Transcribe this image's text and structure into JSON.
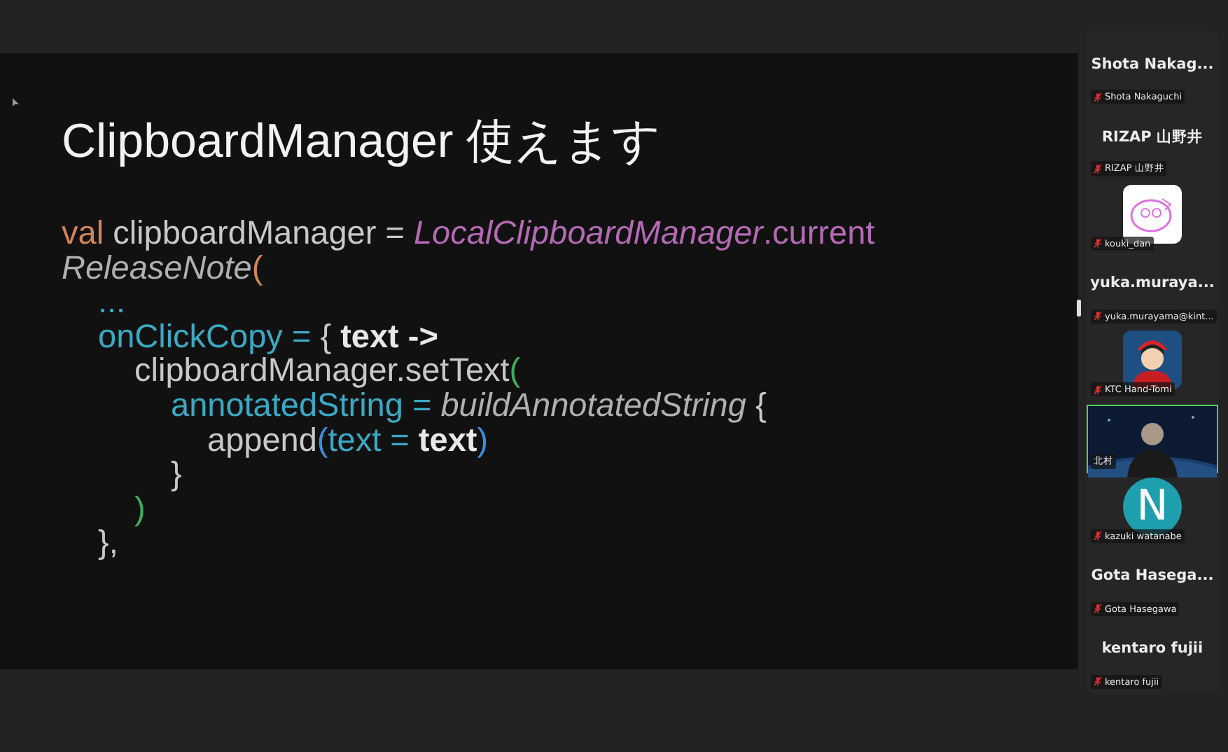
{
  "slide": {
    "title": "ClipboardManager 使えます",
    "code": [
      {
        "tokens": [
          {
            "text": "val ",
            "kind": "keyword"
          },
          {
            "text": "clipboardManager = ",
            "kind": "plain"
          },
          {
            "text": "LocalClipboardManager",
            "kind": "type"
          },
          {
            "text": ".current",
            "kind": "member"
          }
        ]
      },
      {
        "tokens": [
          {
            "text": "ReleaseNote",
            "kind": "italic"
          },
          {
            "text": "(",
            "kind": "paren-orange"
          }
        ],
        "children": [
          {
            "tokens": [
              {
                "text": "...",
                "kind": "param"
              }
            ]
          },
          {
            "tokens": [
              {
                "text": "onClickCopy = ",
                "kind": "param"
              },
              {
                "text": "{ ",
                "kind": "plain"
              },
              {
                "text": "text ->",
                "kind": "bold"
              }
            ],
            "children": [
              {
                "tokens": [
                  {
                    "text": "clipboardManager.setText",
                    "kind": "plain"
                  },
                  {
                    "text": "(",
                    "kind": "paren-green"
                  }
                ],
                "children": [
                  {
                    "tokens": [
                      {
                        "text": "annotatedString = ",
                        "kind": "param"
                      },
                      {
                        "text": "buildAnnotatedString",
                        "kind": "italic"
                      },
                      {
                        "text": " {",
                        "kind": "plain"
                      }
                    ],
                    "children": [
                      {
                        "tokens": [
                          {
                            "text": "append",
                            "kind": "plain"
                          },
                          {
                            "text": "(",
                            "kind": "paren-blue"
                          },
                          {
                            "text": "text = ",
                            "kind": "param"
                          },
                          {
                            "text": "text",
                            "kind": "bold"
                          },
                          {
                            "text": ")",
                            "kind": "paren-blue"
                          }
                        ]
                      }
                    ]
                  },
                  {
                    "tokens": [
                      {
                        "text": "}",
                        "kind": "plain"
                      }
                    ]
                  }
                ]
              },
              {
                "tokens": [
                  {
                    "text": ")",
                    "kind": "paren-green"
                  }
                ]
              }
            ]
          },
          {
            "tokens": [
              {
                "text": "},",
                "kind": "plain"
              }
            ]
          }
        ]
      }
    ]
  },
  "participants": [
    {
      "kind": "name",
      "display_name": "Shota Nakag...",
      "label": "Shota Nakaguchi",
      "muted": true,
      "selected": false
    },
    {
      "kind": "name",
      "display_name": "RIZAP 山野井",
      "label": "RIZAP 山野井",
      "muted": true,
      "selected": false
    },
    {
      "kind": "avatar",
      "label": "kouki_dan",
      "muted": true,
      "selected": false
    },
    {
      "kind": "name",
      "display_name": "yuka.muraya...",
      "label": "yuka.murayama@kint...",
      "muted": true,
      "selected": false
    },
    {
      "kind": "avatar",
      "label": "KTC Hand-Tomi",
      "muted": true,
      "selected": false
    },
    {
      "kind": "video",
      "label": "北村",
      "muted": false,
      "selected": true
    },
    {
      "kind": "letter",
      "letter": "N",
      "label": "kazuki watanabe",
      "muted": true,
      "selected": false
    },
    {
      "kind": "name",
      "display_name": "Gota Hasega...",
      "label": "Gota Hasegawa",
      "muted": true,
      "selected": false
    },
    {
      "kind": "name",
      "display_name": "kentaro fujii",
      "label": "kentaro fujii",
      "muted": true,
      "selected": false
    }
  ]
}
